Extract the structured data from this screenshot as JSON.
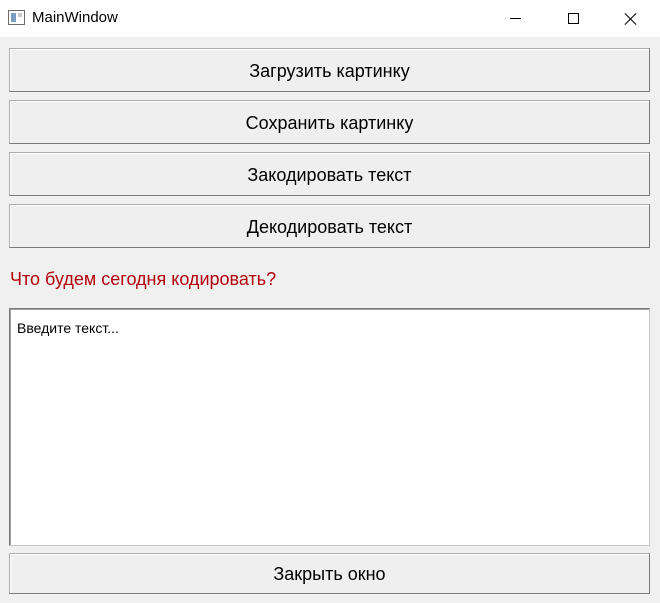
{
  "window": {
    "title": "MainWindow",
    "icons": {
      "app": "app-window-icon",
      "minimize": "minimize-icon",
      "maximize": "maximize-icon",
      "close": "close-icon"
    }
  },
  "buttons": {
    "load": "Загрузить картинку",
    "save": "Сохранить картинку",
    "encode": "Закодировать текст",
    "decode": "Декодировать текст",
    "close": "Закрыть окно"
  },
  "prompt": {
    "text": "Что будем сегодня кодировать?",
    "color": "#b3000c"
  },
  "text_input": {
    "value": "Введите текст..."
  }
}
